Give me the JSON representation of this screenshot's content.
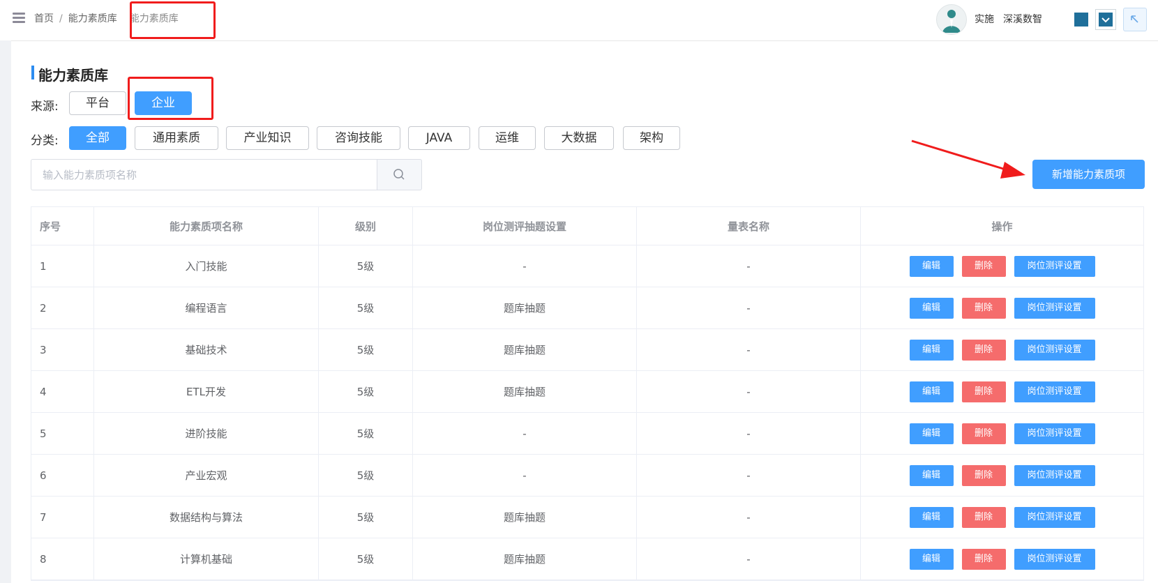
{
  "header": {
    "breadcrumb": [
      "首页",
      "能力素质库"
    ],
    "breadcrumb_separator": "/",
    "current_tab": "能力素质库",
    "user_role": "实施",
    "user_org": "深溪数智"
  },
  "page": {
    "title": "能力素质库"
  },
  "filters": {
    "source_label": "来源:",
    "source_options": [
      "平台",
      "企业"
    ],
    "source_selected": "企业",
    "category_label": "分类:",
    "category_options": [
      "全部",
      "通用素质",
      "产业知识",
      "咨询技能",
      "JAVA",
      "运维",
      "大数据",
      "架构"
    ],
    "category_selected": "全部"
  },
  "search": {
    "placeholder": "输入能力素质项名称",
    "value": ""
  },
  "add_button_label": "新增能力素质项",
  "table": {
    "columns": [
      "序号",
      "能力素质项名称",
      "级别",
      "岗位测评抽题设置",
      "量表名称",
      "操作"
    ],
    "actions": [
      "编辑",
      "删除",
      "岗位测评设置"
    ],
    "rows": [
      {
        "seq": "1",
        "name": "入门技能",
        "level": "5级",
        "draw": "-",
        "scale": "-"
      },
      {
        "seq": "2",
        "name": "编程语言",
        "level": "5级",
        "draw": "题库抽题",
        "scale": "-"
      },
      {
        "seq": "3",
        "name": "基础技术",
        "level": "5级",
        "draw": "题库抽题",
        "scale": "-"
      },
      {
        "seq": "4",
        "name": "ETL开发",
        "level": "5级",
        "draw": "题库抽题",
        "scale": "-"
      },
      {
        "seq": "5",
        "name": "进阶技能",
        "level": "5级",
        "draw": "-",
        "scale": "-"
      },
      {
        "seq": "6",
        "name": "产业宏观",
        "level": "5级",
        "draw": "-",
        "scale": "-"
      },
      {
        "seq": "7",
        "name": "数据结构与算法",
        "level": "5级",
        "draw": "题库抽题",
        "scale": "-"
      },
      {
        "seq": "8",
        "name": "计算机基础",
        "level": "5级",
        "draw": "题库抽题",
        "scale": "-"
      }
    ]
  },
  "colors": {
    "primary": "#409eff",
    "danger": "#f56c6c",
    "annotation": "#f01c1c",
    "theme": "#1f6f9a"
  },
  "icons": {
    "menu": "menu-icon",
    "search": "search-icon",
    "collapse": "arrow-up-left-icon",
    "dropdown": "chevron-down-icon"
  }
}
